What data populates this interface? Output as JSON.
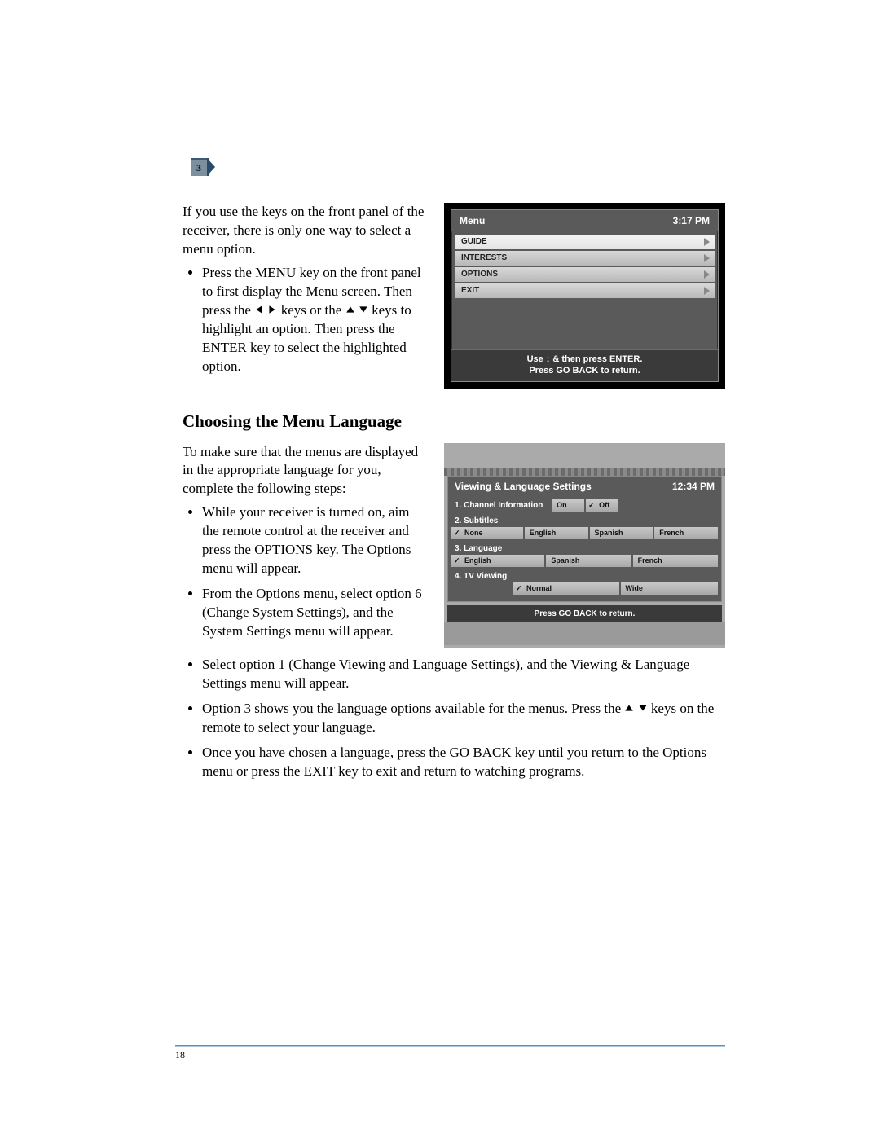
{
  "chapter_number": "3",
  "intro_para": "If you use the keys on the front panel of the receiver, there is only one way to select a menu option.",
  "bullet1_a": "Press the MENU key on the front panel to first display the Menu screen. Then press the",
  "bullet1_b": "keys or the",
  "bullet1_c": "keys to highlight an option. Then press the ENTER key to select the highlighted option.",
  "menu_screen": {
    "title": "Menu",
    "time": "3:17 PM",
    "items": [
      "GUIDE",
      "INTERESTS",
      "OPTIONS",
      "EXIT"
    ],
    "hint_line1": "Use ↕ & then press ENTER.",
    "hint_line2": "Press GO BACK to return."
  },
  "section_heading": "Choosing the Menu Language",
  "para2": "To make sure that the menus are displayed in the appropriate language for you, complete the following steps:",
  "bullets2": {
    "a": "While your receiver is turned on, aim the remote control at the receiver and press the OPTIONS key. The Options menu will appear.",
    "b": "From the Options menu, select option 6 (Change System Settings), and the System Settings menu will appear.",
    "c": "Select option 1 (Change Viewing and Language Settings), and the Viewing & Language Settings menu will appear.",
    "d_a": "Option 3 shows you the language options available for the menus. Press the",
    "d_b": "keys on the remote to select your language.",
    "e": "Once you have chosen a language, press the GO BACK key until you return to the Options menu or press the EXIT key to exit and return to watching programs."
  },
  "settings_screen": {
    "title": "Viewing & Language Settings",
    "time": "12:34 PM",
    "row1_label": "1. Channel Information",
    "row1_opts": [
      "On",
      "Off"
    ],
    "row2_label": "2. Subtitles",
    "row2_opts": [
      "None",
      "English",
      "Spanish",
      "French"
    ],
    "row3_label": "3. Language",
    "row3_opts": [
      "English",
      "Spanish",
      "French"
    ],
    "row4_label": "4. TV Viewing",
    "row4_opts": [
      "Normal",
      "Wide"
    ],
    "hint": "Press GO BACK to return."
  },
  "page_number": "18"
}
